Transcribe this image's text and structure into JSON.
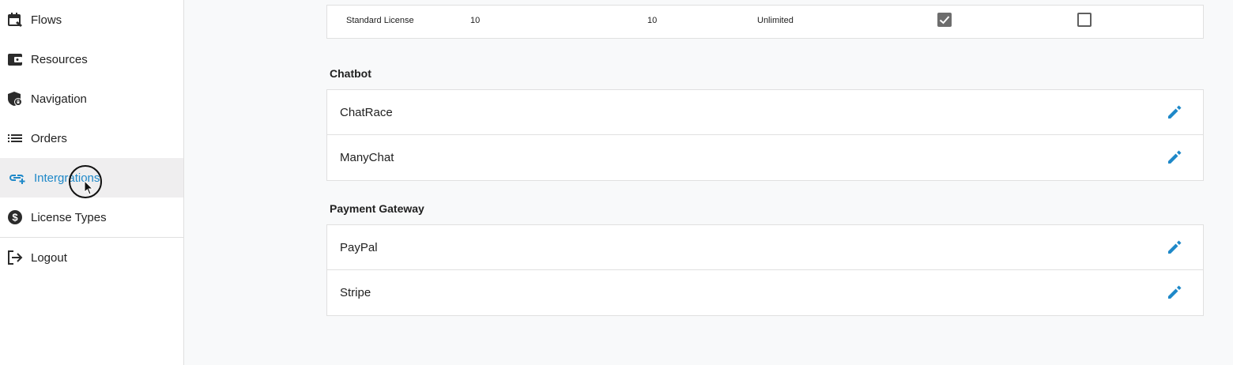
{
  "sidebar": {
    "items": [
      {
        "label": "Flows",
        "icon": "calendar-edit-icon"
      },
      {
        "label": "Resources",
        "icon": "wallet-icon"
      },
      {
        "label": "Navigation",
        "icon": "shield-lock-icon"
      },
      {
        "label": "Orders",
        "icon": "list-icon"
      },
      {
        "label": "Intergrations",
        "icon": "link-add-icon",
        "active": true
      },
      {
        "label": "License Types",
        "icon": "dollar-circle-icon"
      },
      {
        "label": "Logout",
        "icon": "logout-icon"
      }
    ]
  },
  "license_row": {
    "name": "Standard License",
    "col2": "10",
    "col3": "10",
    "col4": "Unlimited",
    "check1": true,
    "check2": false
  },
  "sections": [
    {
      "title": "Chatbot",
      "items": [
        "ChatRace",
        "ManyChat"
      ]
    },
    {
      "title": "Payment Gateway",
      "items": [
        "PayPal",
        "Stripe"
      ]
    }
  ],
  "colors": {
    "accent": "#1e88c8",
    "active_bg": "#efeeef"
  }
}
